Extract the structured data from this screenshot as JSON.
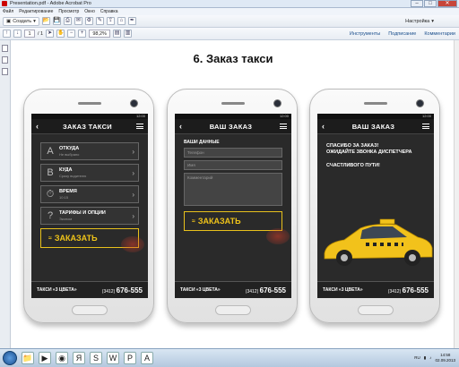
{
  "window": {
    "title": "Presentation.pdf - Adobe Acrobat Pro",
    "min": "–",
    "max": "□",
    "close": "✕"
  },
  "menu": [
    "Файл",
    "Редактирование",
    "Просмотр",
    "Окно",
    "Справка"
  ],
  "toolbar": {
    "create_label": "Создать",
    "customize_label": "Настройка"
  },
  "nav": {
    "page_current": "1",
    "page_total": "/ 1",
    "zoom": "98,2%"
  },
  "right_links": [
    "Инструменты",
    "Подписание",
    "Комментарии"
  ],
  "page": {
    "title": "6. Заказ такси"
  },
  "phone1": {
    "status": "12:00",
    "title": "ЗАКАЗ ТАКСИ",
    "rows": [
      {
        "icon": "A",
        "label": "ОТКУДА",
        "sub": "Не выбрано"
      },
      {
        "icon": "B",
        "label": "КУДА",
        "sub": "Сразу водителю"
      },
      {
        "icon": "⏱",
        "label": "ВРЕМЯ",
        "sub": "10:15"
      },
      {
        "icon": "?",
        "label": "ТАРИФЫ И ОПЦИИ",
        "sub": "Эконом"
      }
    ],
    "button": "ЗАКАЗАТЬ",
    "footer_left": "ТАКСИ «3 ЦВЕТА»",
    "footer_code": "(3412)",
    "footer_num": "676-555"
  },
  "phone2": {
    "status": "12:00",
    "title": "ВАШ ЗАКАЗ",
    "section": "ВАШИ ДАННЫЕ",
    "fields": [
      "Телефон",
      "Имя",
      "Комментарий"
    ],
    "button": "ЗАКАЗАТЬ",
    "footer_left": "ТАКСИ «3 ЦВЕТА»",
    "footer_code": "(3412)",
    "footer_num": "676-555"
  },
  "phone3": {
    "status": "12:00",
    "title": "ВАШ ЗАКАЗ",
    "message1": "СПАСИБО ЗА ЗАКАЗ!",
    "message2": "ОЖИДАЙТЕ ЗВОНКА ДИСПЕТЧЕРА",
    "message3": "СЧАСТЛИВОГО ПУТИ!",
    "footer_left": "ТАКСИ «3 ЦВЕТА»",
    "footer_code": "(3412)",
    "footer_num": "676-555"
  },
  "taskbar": {
    "clock_time": "14:58",
    "clock_date": "02.09.2013",
    "lang": "RU"
  },
  "colors": {
    "accent_yellow": "#f0c419",
    "app_dark": "#2a2a2a"
  }
}
